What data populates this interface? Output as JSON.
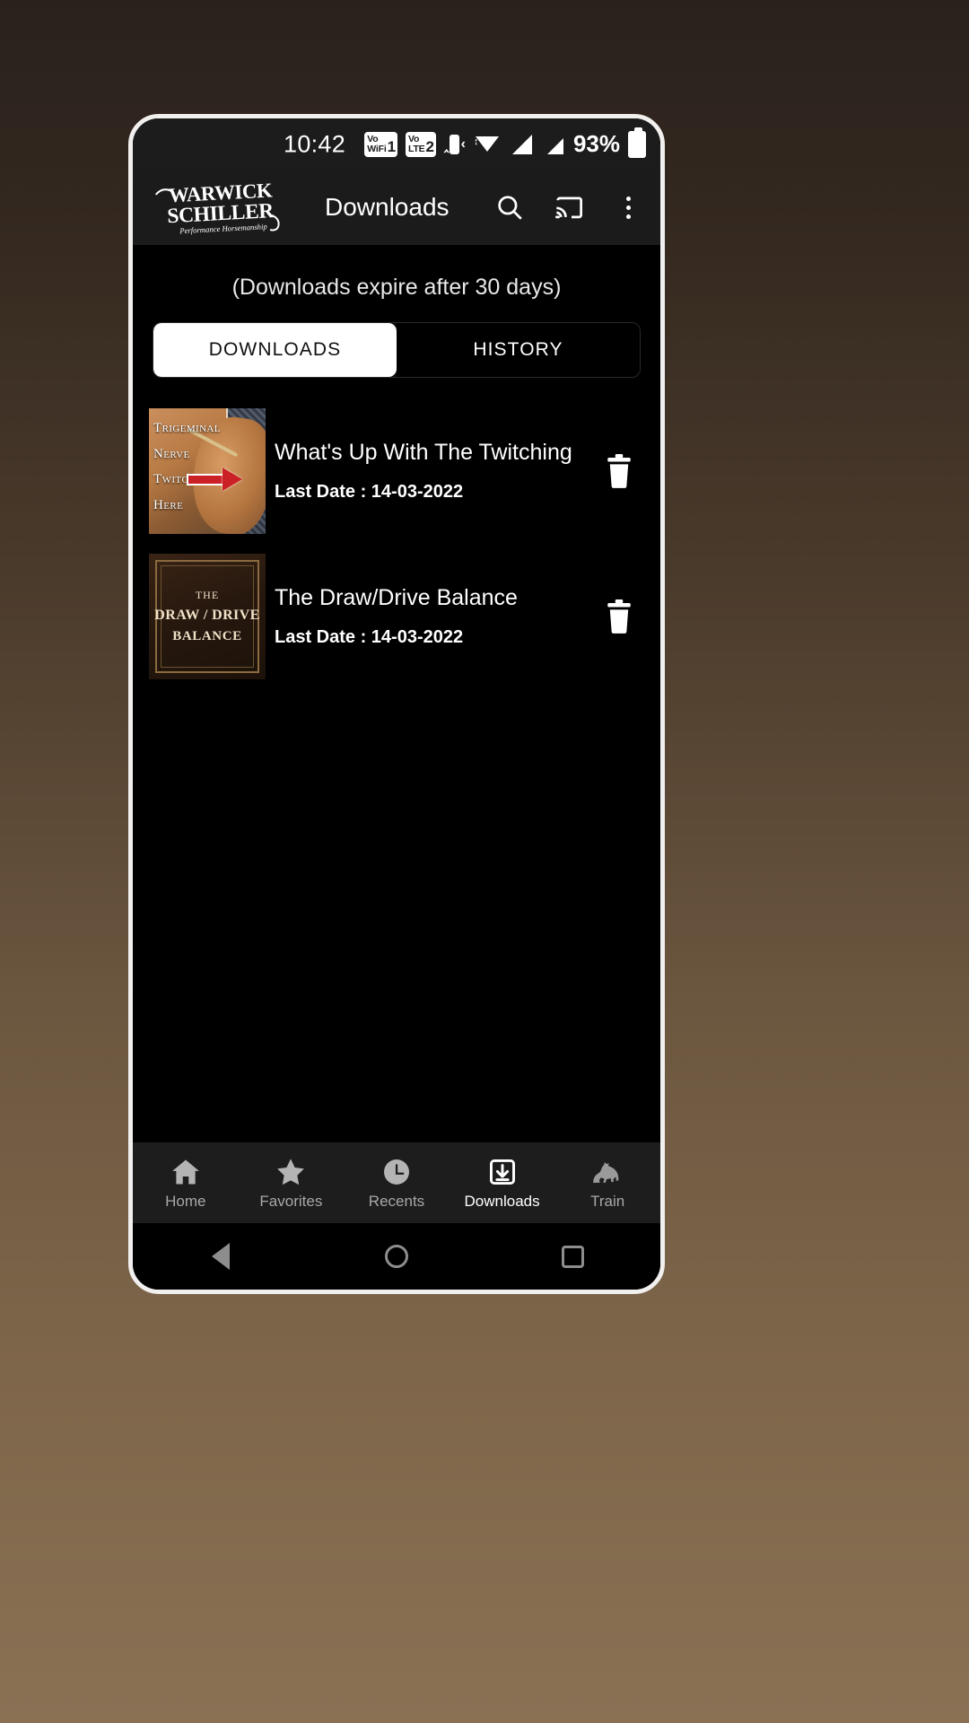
{
  "statusbar": {
    "time": "10:42",
    "vowifi": {
      "line1": "Vo",
      "line2": "WiFi",
      "sim": "1"
    },
    "volte": {
      "line1": "Vo",
      "line2": "LTE",
      "sim": "2"
    },
    "vibrate_icon": "vibrate-icon",
    "wifi_icon": "wifi-icon",
    "signal1_icon": "signal-bars-icon",
    "signal2_icon": "signal-bars-icon",
    "battery_percent": "93%",
    "battery_icon": "battery-icon"
  },
  "appbar": {
    "logo_line1": "WARWICK",
    "logo_line2": "SCHILLER",
    "logo_tagline": "Performance Horsemanship",
    "title": "Downloads",
    "search_icon": "search-icon",
    "cast_icon": "cast-icon",
    "overflow_icon": "more-vertical-icon"
  },
  "content": {
    "expiry_notice": "(Downloads expire after 30 days)",
    "tabs": [
      {
        "label": "DOWNLOADS",
        "active": true
      },
      {
        "label": "HISTORY",
        "active": false
      }
    ],
    "downloads": [
      {
        "title": "What's Up With The Twitching",
        "date_label": "Last Date : 14-03-2022",
        "delete_icon": "trash-icon",
        "thumb_type": "photo",
        "thumb_caption": [
          "TRIGEMINAL",
          "NERVE",
          "TWITCHING",
          "HERE"
        ]
      },
      {
        "title": "The Draw/Drive Balance",
        "date_label": "Last Date : 14-03-2022",
        "delete_icon": "trash-icon",
        "thumb_type": "titlecard",
        "thumb_lines": [
          "THE",
          "DRAW / DRIVE",
          "BALANCE"
        ]
      }
    ]
  },
  "bottomnav": [
    {
      "label": "Home",
      "icon": "home-icon",
      "active": false
    },
    {
      "label": "Favorites",
      "icon": "star-icon",
      "active": false
    },
    {
      "label": "Recents",
      "icon": "clock-icon",
      "active": false
    },
    {
      "label": "Downloads",
      "icon": "download-icon",
      "active": true
    },
    {
      "label": "Train",
      "icon": "horse-icon",
      "active": false
    }
  ],
  "sysnav": {
    "back_icon": "back-triangle-icon",
    "home_icon": "home-circle-icon",
    "recents_icon": "recents-square-icon"
  },
  "colors": {
    "accent_white": "#ffffff",
    "appbar_bg": "#1b1b1b",
    "screen_bg": "#000000",
    "inactive_nav": "#a8a8a8"
  }
}
